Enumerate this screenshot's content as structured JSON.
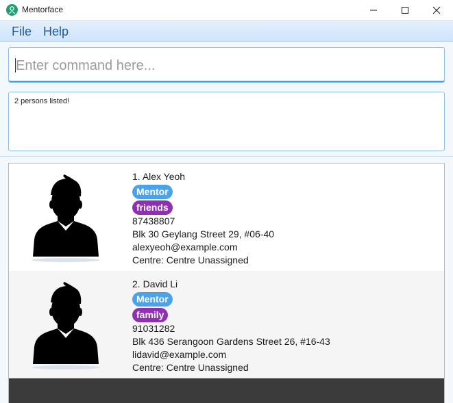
{
  "window": {
    "title": "Mentorface"
  },
  "menu": {
    "file": "File",
    "help": "Help"
  },
  "command": {
    "placeholder": "Enter command here...",
    "value": ""
  },
  "result": {
    "text": "2 persons listed!"
  },
  "colors": {
    "mentor_tag": "#4aa3ea",
    "relation_tag": "#8e2fb5",
    "accent": "#4f97d8"
  },
  "persons": [
    {
      "index": "1.",
      "name": "Alex Yeoh",
      "role_tag": "Mentor",
      "tag": "friends",
      "phone": "87438807",
      "address": "Blk 30 Geylang Street 29, #06-40",
      "email": "alexyeoh@example.com",
      "centre": "Centre: Centre Unassigned"
    },
    {
      "index": "2.",
      "name": "David Li",
      "role_tag": "Mentor",
      "tag": "family",
      "phone": "91031282",
      "address": "Blk 436 Serangoon Gardens Street 26, #16-43",
      "email": "lidavid@example.com",
      "centre": "Centre: Centre Unassigned"
    }
  ]
}
